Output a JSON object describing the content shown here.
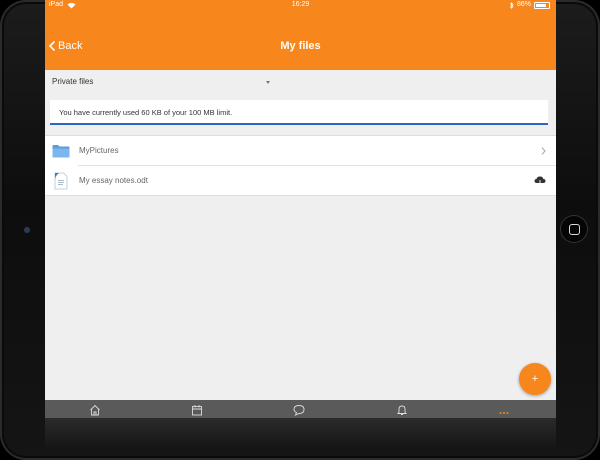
{
  "status": {
    "carrier": "iPad",
    "time": "16:29",
    "battery": "86%"
  },
  "nav": {
    "back_label": "Back",
    "title": "My files"
  },
  "filter": {
    "selected": "Private files"
  },
  "quota": {
    "message": "You have currently used 60 KB of your 100 MB limit."
  },
  "files": [
    {
      "name": "MyPictures",
      "type": "folder",
      "end_icon": "chevron-right-icon"
    },
    {
      "name": "My essay notes.odt",
      "type": "document",
      "end_icon": "cloud-download-icon"
    }
  ],
  "fab": {
    "label": "+"
  },
  "tabs": [
    {
      "name": "home",
      "icon": "home-icon"
    },
    {
      "name": "calendar",
      "icon": "calendar-icon"
    },
    {
      "name": "messages",
      "icon": "chat-icon"
    },
    {
      "name": "notifications",
      "icon": "bell-icon"
    },
    {
      "name": "more",
      "icon": "more-icon"
    }
  ],
  "colors": {
    "accent": "#f7861c",
    "tabbar": "#5a5a5a",
    "quota_border": "#2b66c4"
  }
}
